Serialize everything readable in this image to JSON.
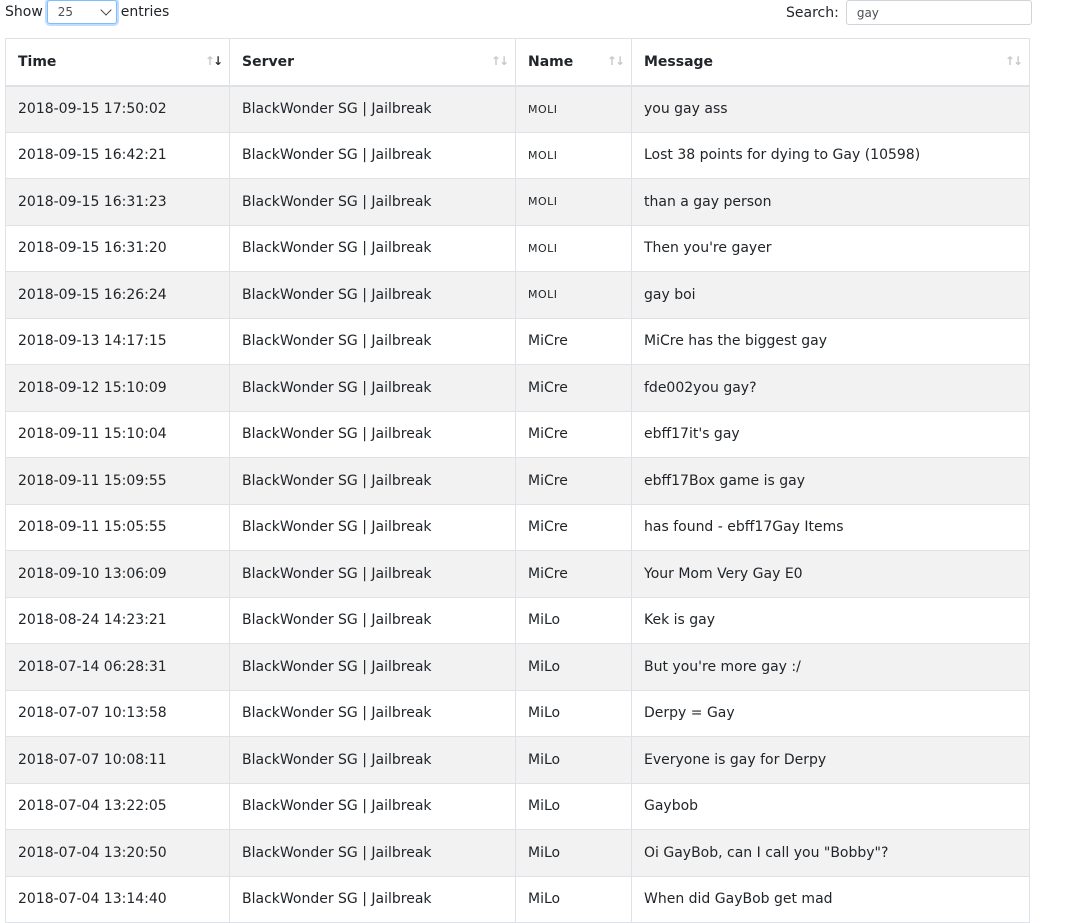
{
  "length": {
    "show_label": "Show",
    "selected": "25",
    "entries_label": "entries"
  },
  "search": {
    "label": "Search:",
    "value": "gay"
  },
  "columns": [
    {
      "label": "Time"
    },
    {
      "label": "Server"
    },
    {
      "label": "Name"
    },
    {
      "label": "Message"
    }
  ],
  "rows": [
    {
      "time": "2018-09-15 17:50:02",
      "server": "BlackWonder SG | Jailbreak",
      "name": "MOLI",
      "message": "you gay ass"
    },
    {
      "time": "2018-09-15 16:42:21",
      "server": "BlackWonder SG | Jailbreak",
      "name": "MOLI",
      "message": "Lost 38 points for dying to Gay (10598)"
    },
    {
      "time": "2018-09-15 16:31:23",
      "server": "BlackWonder SG | Jailbreak",
      "name": "MOLI",
      "message": "than a gay person"
    },
    {
      "time": "2018-09-15 16:31:20",
      "server": "BlackWonder SG | Jailbreak",
      "name": "MOLI",
      "message": "Then you're gayer"
    },
    {
      "time": "2018-09-15 16:26:24",
      "server": "BlackWonder SG | Jailbreak",
      "name": "MOLI",
      "message": "gay boi"
    },
    {
      "time": "2018-09-13 14:17:15",
      "server": "BlackWonder SG | Jailbreak",
      "name": "MiCre",
      "message": "MiCre has the biggest gay"
    },
    {
      "time": "2018-09-12 15:10:09",
      "server": "BlackWonder SG | Jailbreak",
      "name": "MiCre",
      "message": "fde002you gay?"
    },
    {
      "time": "2018-09-11 15:10:04",
      "server": "BlackWonder SG | Jailbreak",
      "name": "MiCre",
      "message": "ebff17it's gay"
    },
    {
      "time": "2018-09-11 15:09:55",
      "server": "BlackWonder SG | Jailbreak",
      "name": "MiCre",
      "message": "ebff17Box game is gay"
    },
    {
      "time": "2018-09-11 15:05:55",
      "server": "BlackWonder SG | Jailbreak",
      "name": "MiCre",
      "message": "has found - ebff17Gay Items"
    },
    {
      "time": "2018-09-10 13:06:09",
      "server": "BlackWonder SG | Jailbreak",
      "name": "MiCre",
      "message": "Your Mom Very Gay E0"
    },
    {
      "time": "2018-08-24 14:23:21",
      "server": "BlackWonder SG | Jailbreak",
      "name": "MiLo",
      "message": "Kek is gay"
    },
    {
      "time": "2018-07-14 06:28:31",
      "server": "BlackWonder SG | Jailbreak",
      "name": "MiLo",
      "message": "But you're more gay :/"
    },
    {
      "time": "2018-07-07 10:13:58",
      "server": "BlackWonder SG | Jailbreak",
      "name": "MiLo",
      "message": "Derpy = Gay"
    },
    {
      "time": "2018-07-07 10:08:11",
      "server": "BlackWonder SG | Jailbreak",
      "name": "MiLo",
      "message": "Everyone is gay for Derpy"
    },
    {
      "time": "2018-07-04 13:22:05",
      "server": "BlackWonder SG | Jailbreak",
      "name": "MiLo",
      "message": "Gaybob"
    },
    {
      "time": "2018-07-04 13:20:50",
      "server": "BlackWonder SG | Jailbreak",
      "name": "MiLo",
      "message": "Oi GayBob, can I call you \"Bobby\"?"
    },
    {
      "time": "2018-07-04 13:14:40",
      "server": "BlackWonder SG | Jailbreak",
      "name": "MiLo",
      "message": "When did GayBob get mad"
    }
  ]
}
